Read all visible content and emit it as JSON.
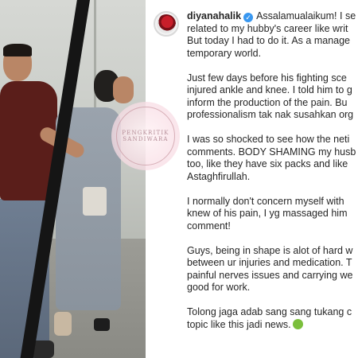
{
  "watermark": {
    "line1": "PENGKRITIK",
    "line2": "SANDIWARA"
  },
  "post": {
    "username": "diyanahalik",
    "lines": [
      [
        "Assalamualaikum! I se"
      ],
      [
        "related to my hubby's career like writ"
      ],
      [
        "But today I had to do it. As a manage"
      ],
      [
        "temporary world."
      ],
      [],
      [
        "Just few days before his fighting sce"
      ],
      [
        "injured ankle and knee. I told him to g"
      ],
      [
        "inform the production of the pain. Bu"
      ],
      [
        "professionalism tak nak susahkan org"
      ],
      [],
      [
        "I was so shocked to see how the neti"
      ],
      [
        "comments. BODY SHAMING my husb"
      ],
      [
        "too, like they have six packs and like"
      ],
      [
        "Astaghfirullah."
      ],
      [],
      [
        "I normally don't concern myself with"
      ],
      [
        "knew of his pain, I yg massaged him"
      ],
      [
        "comment!"
      ],
      [],
      [
        "Guys, being in shape is alot of hard w"
      ],
      [
        "between ur injuries and medication. T"
      ],
      [
        "painful nerves issues and carrying we"
      ],
      [
        "good for work."
      ],
      [],
      [
        "Tolong jaga adab sang sang tukang c"
      ],
      [
        "topic like this jadi news."
      ]
    ],
    "verified_glyph": "✓",
    "end_emoji": "green-face-emoji"
  }
}
